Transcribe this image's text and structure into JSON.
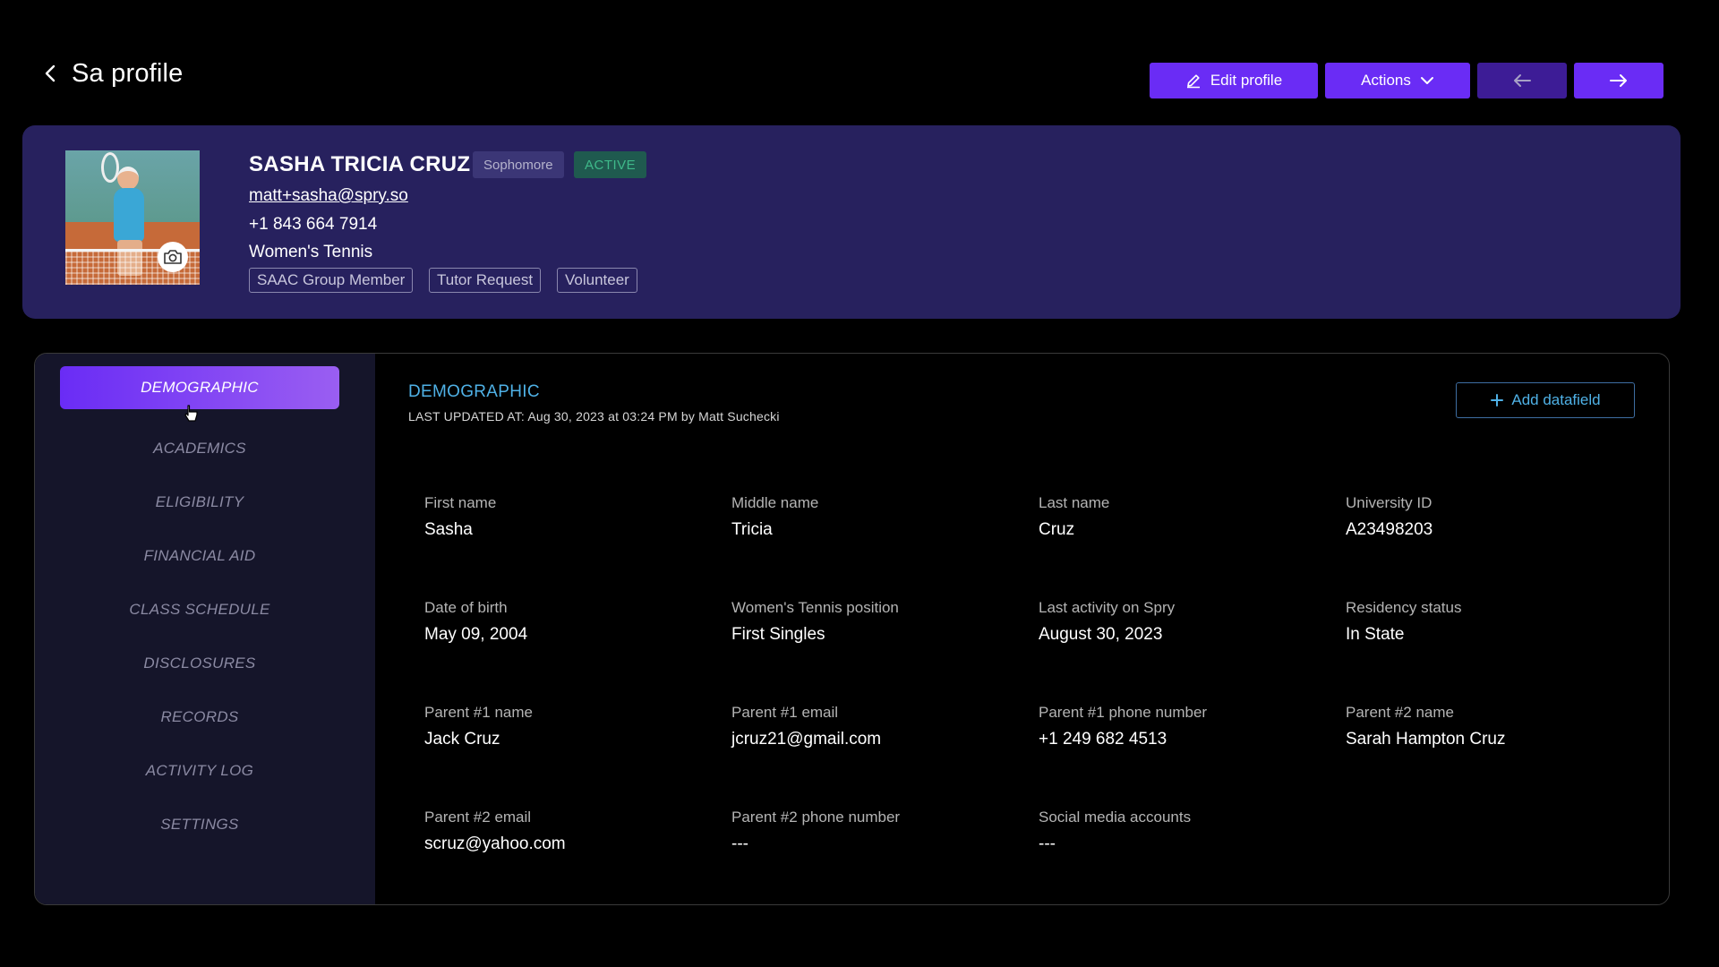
{
  "header": {
    "title": "Sa profile",
    "edit_label": "Edit profile",
    "actions_label": "Actions"
  },
  "profile": {
    "name": "SASHA TRICIA CRUZ",
    "year": "Sophomore",
    "status": "ACTIVE",
    "email": "matt+sasha@spry.so",
    "phone": "+1 843 664 7914",
    "team": "Women's Tennis",
    "tags": [
      "SAAC Group Member",
      "Tutor Request",
      "Volunteer"
    ]
  },
  "nav": {
    "items": [
      {
        "label": "DEMOGRAPHIC",
        "active": true
      },
      {
        "label": "ACADEMICS"
      },
      {
        "label": "ELIGIBILITY"
      },
      {
        "label": "FINANCIAL AID"
      },
      {
        "label": "CLASS SCHEDULE"
      },
      {
        "label": "DISCLOSURES"
      },
      {
        "label": "RECORDS"
      },
      {
        "label": "ACTIVITY LOG"
      },
      {
        "label": "SETTINGS"
      }
    ]
  },
  "section": {
    "title": "DEMOGRAPHIC",
    "updated": "LAST UPDATED AT: Aug 30, 2023 at 03:24 PM by Matt Suchecki",
    "add_label": "Add datafield"
  },
  "fields": [
    {
      "label": "First name",
      "value": "Sasha"
    },
    {
      "label": "Middle name",
      "value": "Tricia"
    },
    {
      "label": "Last name",
      "value": "Cruz"
    },
    {
      "label": "University ID",
      "value": "A23498203"
    },
    {
      "label": "Date of birth",
      "value": "May 09, 2004"
    },
    {
      "label": "Women's Tennis position",
      "value": "First Singles"
    },
    {
      "label": "Last activity on Spry",
      "value": "August 30, 2023"
    },
    {
      "label": "Residency status",
      "value": "In State"
    },
    {
      "label": "Parent #1 name",
      "value": "Jack Cruz"
    },
    {
      "label": "Parent #1 email",
      "value": "jcruz21@gmail.com"
    },
    {
      "label": "Parent #1 phone number",
      "value": "+1 249 682 4513"
    },
    {
      "label": "Parent #2 name",
      "value": "Sarah Hampton Cruz"
    },
    {
      "label": "Parent #2 email",
      "value": "scruz@yahoo.com"
    },
    {
      "label": "Parent #2 phone number",
      "value": "---"
    },
    {
      "label": "Social media accounts",
      "value": "---"
    }
  ],
  "colors": {
    "accent": "#6a2cf5",
    "card_bg": "#27215e",
    "link_blue": "#4fb1e6",
    "active_green": "#3fb98a"
  }
}
